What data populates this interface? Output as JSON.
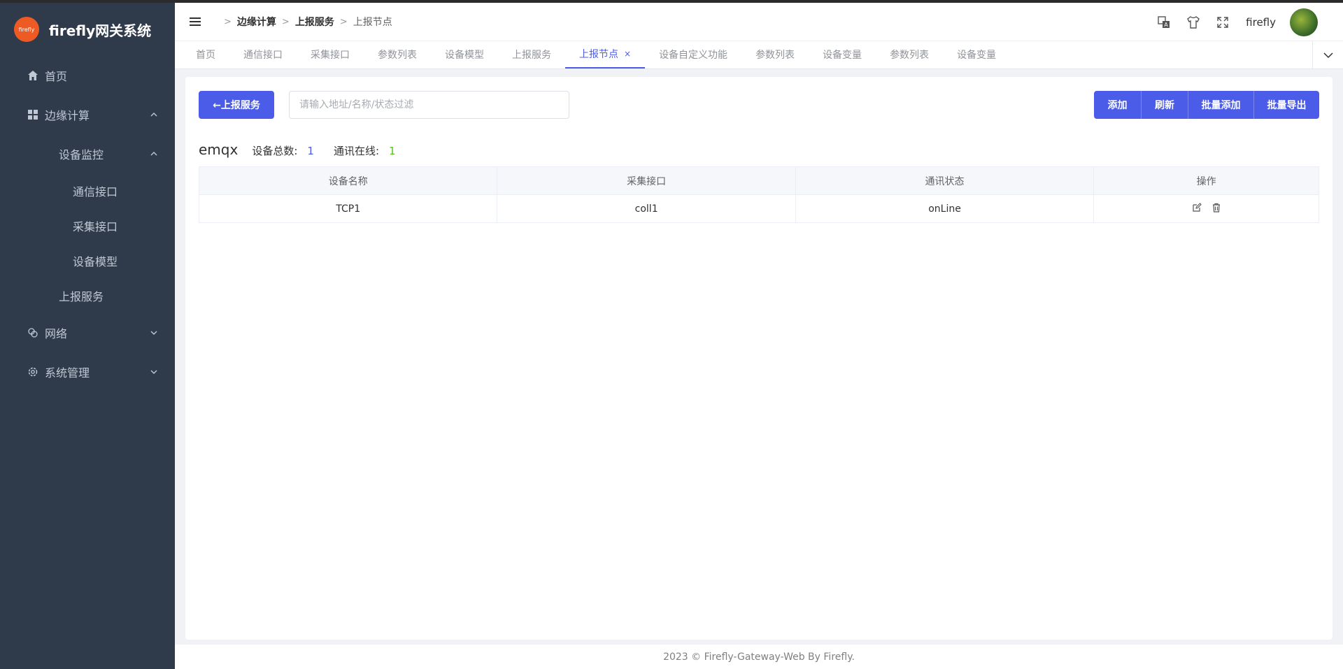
{
  "sidebar": {
    "logo_text": "firefly",
    "title": "firefly网关系统",
    "items": {
      "home": "首页",
      "edge": "边缘计算",
      "monitor": "设备监控",
      "comm": "通信接口",
      "collect": "采集接口",
      "model": "设备模型",
      "report": "上报服务",
      "network": "网络",
      "system": "系统管理"
    }
  },
  "header": {
    "breadcrumb": [
      "边缘计算",
      "上报服务",
      "上报节点"
    ],
    "username": "firefly"
  },
  "tabs": [
    {
      "label": "首页"
    },
    {
      "label": "通信接口"
    },
    {
      "label": "采集接口"
    },
    {
      "label": "参数列表"
    },
    {
      "label": "设备模型"
    },
    {
      "label": "上报服务"
    },
    {
      "label": "上报节点",
      "close": "×"
    },
    {
      "label": "设备自定义功能"
    },
    {
      "label": "参数列表"
    },
    {
      "label": "设备变量"
    },
    {
      "label": "参数列表"
    },
    {
      "label": "设备变量"
    }
  ],
  "main": {
    "back_label": "←上报服务",
    "filter_placeholder": "请输入地址/名称/状态过滤",
    "buttons": {
      "add": "添加",
      "refresh": "刷新",
      "batch_add": "批量添加",
      "batch_export": "批量导出"
    },
    "service_name": "emqx",
    "total_label": "设备总数:",
    "total_value": "1",
    "online_label": "通讯在线:",
    "online_value": "1",
    "columns": [
      "设备名称",
      "采集接口",
      "通讯状态",
      "操作"
    ],
    "rows": [
      {
        "name": "TCP1",
        "collector": "coll1",
        "status": "onLine"
      }
    ]
  },
  "footer": "2023 © Firefly-Gateway-Web By Firefly.",
  "colors": {
    "accent": "#4b5ce8",
    "sidebar_bg": "#2f3a4a",
    "online": "#52c41a"
  },
  "icons": [
    "home-icon",
    "grid-icon",
    "network-icon",
    "gear-icon",
    "hamburger-icon",
    "translate-icon",
    "shirt-icon",
    "fullscreen-icon",
    "edit-icon",
    "delete-icon",
    "chevron-down-icon",
    "chevron-up-icon"
  ]
}
